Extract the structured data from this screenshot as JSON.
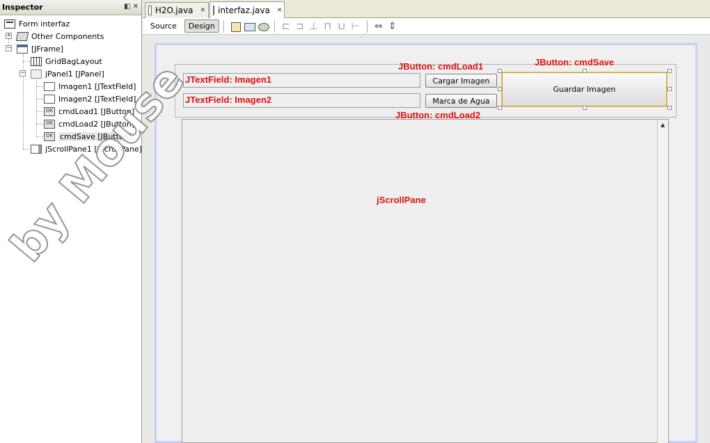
{
  "inspector": {
    "title": "Inspector",
    "tree": {
      "form": "Form interfaz",
      "other": "Other Components",
      "frame": "[JFrame]",
      "layout": "GridBagLayout",
      "panel": "jPanel1 [JPanel]",
      "imagen1": "Imagen1 [JTextField]",
      "imagen2": "Imagen2 [JTextField]",
      "cmdLoad1": "cmdLoad1 [JButton]",
      "cmdLoad2": "cmdLoad2 [JButton]",
      "cmdSave": "cmdSave [JButton]",
      "scroll": "jScrollPane1 [JScrollPane]"
    }
  },
  "tabs": [
    {
      "label": "H2O.java"
    },
    {
      "label": "interfaz.java"
    }
  ],
  "toolbar": {
    "source": "Source",
    "design": "Design"
  },
  "form": {
    "btn_load1": "Cargar Imagen",
    "btn_load2": "Marca de Agua",
    "btn_save": "Guardar Imagen"
  },
  "annotations": {
    "field1": "JTextField: Imagen1",
    "field2": "JTextField: Imagen2",
    "load1": "JButton: cmdLoad1",
    "save": "JButton: cmdSave",
    "load2": "JButton: cmdLoad2",
    "scroll": "jScrollPane"
  },
  "watermark": "by Mouse",
  "colors": {
    "annotation": "#e01010",
    "selection_border": "#bf9c3c",
    "frame_border": "#c7d0f2"
  }
}
